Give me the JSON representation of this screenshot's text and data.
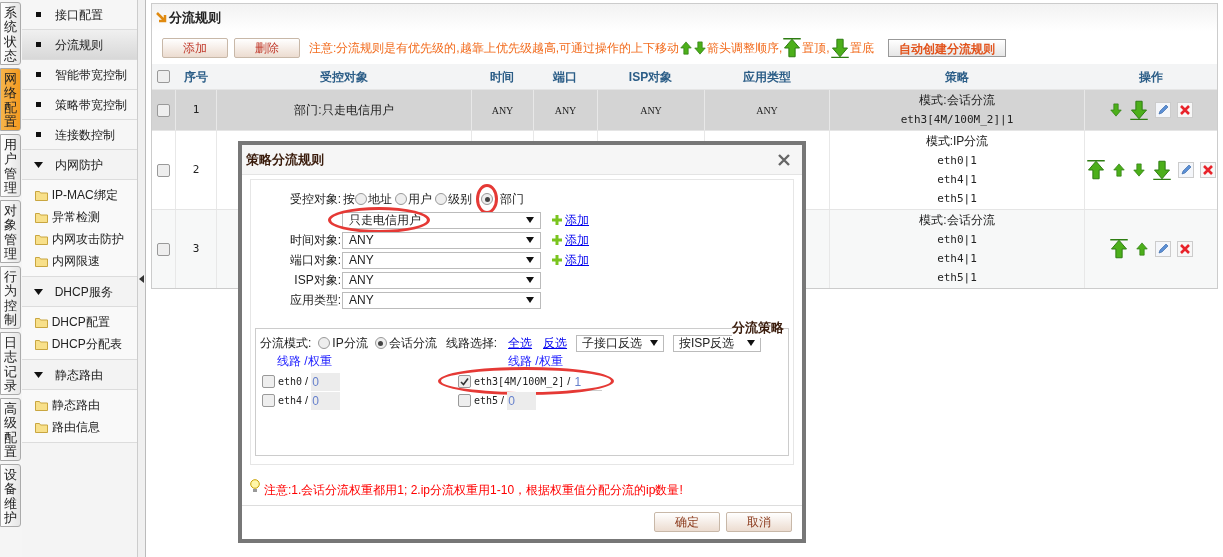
{
  "side_tabs": [
    {
      "label": "系统状态",
      "selected": false
    },
    {
      "label": "网络配置",
      "selected": true
    },
    {
      "label": "用户管理",
      "selected": false
    },
    {
      "label": "对象管理",
      "selected": false
    },
    {
      "label": "行为控制",
      "selected": false
    },
    {
      "label": "日志记录",
      "selected": false
    },
    {
      "label": "高级配置",
      "selected": false
    },
    {
      "label": "设备维护",
      "selected": false
    }
  ],
  "menu": [
    {
      "kind": "item",
      "label": "接口配置",
      "selected": false
    },
    {
      "kind": "item",
      "label": "分流规则",
      "selected": true
    },
    {
      "kind": "item",
      "label": "智能带宽控制",
      "selected": false
    },
    {
      "kind": "item",
      "label": "策略带宽控制",
      "selected": false
    },
    {
      "kind": "item",
      "label": "连接数控制",
      "selected": false
    },
    {
      "kind": "group",
      "label": "内网防护",
      "expanded": true,
      "children": [
        {
          "label": "IP-MAC绑定"
        },
        {
          "label": "异常检测"
        },
        {
          "label": "内网攻击防护"
        },
        {
          "label": "内网限速"
        }
      ]
    },
    {
      "kind": "group",
      "label": "DHCP服务",
      "expanded": true,
      "children": [
        {
          "label": "DHCP配置"
        },
        {
          "label": "DHCP分配表"
        }
      ]
    },
    {
      "kind": "group",
      "label": "静态路由",
      "expanded": true,
      "children": [
        {
          "label": "静态路由"
        },
        {
          "label": "路由信息"
        }
      ]
    }
  ],
  "panel": {
    "title": "分流规则",
    "buttons": [
      "添加",
      "删除"
    ],
    "notice": [
      "注意:分流规则是有优先级的,越靠上优先级越高,可通过操作的上下移动",
      "箭头调整顺序,",
      "置顶,",
      "置底"
    ],
    "auto_button": "自动创建分流规则",
    "table": {
      "all_checked": false,
      "columns": [
        "序号",
        "受控对象",
        "时间",
        "端口",
        "ISP对象",
        "应用类型",
        "策略",
        "操作"
      ],
      "rows": [
        {
          "selected": true,
          "checked": false,
          "index": "1",
          "target": "部门:只走电信用户",
          "time": "ANY",
          "port": "ANY",
          "isp": "ANY",
          "app": "ANY",
          "policy": [
            "模式:会话分流",
            "eth3[4M/100M_2]|1"
          ],
          "actions": [
            {
              "kind": "down"
            },
            {
              "kind": "bottom"
            },
            {
              "kind": "edit"
            },
            {
              "kind": "delete"
            }
          ]
        },
        {
          "selected": false,
          "checked": false,
          "index": "2",
          "policy": [
            "模式:IP分流",
            "eth0|1",
            "eth4|1",
            "eth5|1"
          ],
          "actions": [
            {
              "kind": "top"
            },
            {
              "kind": "up"
            },
            {
              "kind": "down"
            },
            {
              "kind": "bottom"
            },
            {
              "kind": "edit"
            },
            {
              "kind": "delete"
            }
          ]
        },
        {
          "selected": false,
          "checked": false,
          "index": "3",
          "policy": [
            "模式:会话分流",
            "eth0|1",
            "eth4|1",
            "eth5|1"
          ],
          "actions": [
            {
              "kind": "top"
            },
            {
              "kind": "up"
            },
            {
              "kind": "edit"
            },
            {
              "kind": "delete"
            }
          ]
        }
      ]
    }
  },
  "dialog": {
    "title": "策略分流规则",
    "target": {
      "label": "受控对象:",
      "prefix": "按",
      "options": [
        {
          "label": "地址",
          "selected": false,
          "circled": false
        },
        {
          "label": "用户",
          "selected": false,
          "circled": false
        },
        {
          "label": "级别",
          "selected": false,
          "circled": false
        },
        {
          "label": "部门",
          "selected": true,
          "circled": true
        }
      ]
    },
    "selects": [
      {
        "value": "只走电信用户",
        "add": "添加",
        "circled": true
      },
      {
        "label": "时间对象:",
        "value": "ANY",
        "add": "添加",
        "circled": false
      },
      {
        "label": "端口对象:",
        "value": "ANY",
        "add": "添加",
        "circled": false
      },
      {
        "label": "ISP对象:",
        "value": "ANY",
        "circled": false
      },
      {
        "label": "应用类型:",
        "value": "ANY",
        "circled": false
      }
    ],
    "strategy": {
      "legend": "分流策略",
      "mode_label": "分流模式:",
      "modes": [
        {
          "label": "IP分流",
          "selected": false
        },
        {
          "label": "会话分流",
          "selected": true
        }
      ],
      "line_label": "线路选择:",
      "links": [
        "全选",
        "反选"
      ],
      "dropdowns": [
        "子接口反选",
        "按ISP反选"
      ],
      "separator": "/",
      "columns": [
        {
          "header": "线路 /权重",
          "lines": [
            {
              "name": "eth0",
              "checked": false,
              "weight": "0",
              "circled": false
            },
            {
              "name": "eth4",
              "checked": false,
              "weight": "0",
              "circled": false
            }
          ]
        },
        {
          "header": "线路 /权重",
          "lines": [
            {
              "name": "eth3[4M/100M_2]",
              "checked": true,
              "weight": "1",
              "circled": true
            },
            {
              "name": "eth5",
              "checked": false,
              "weight": "0",
              "circled": false
            }
          ]
        }
      ]
    },
    "note": "注意:1.会话分流权重都用1; 2.ip分流权重用1-10，根据权重值分配分流的ip数量!",
    "buttons": [
      "确定",
      "取消"
    ]
  }
}
